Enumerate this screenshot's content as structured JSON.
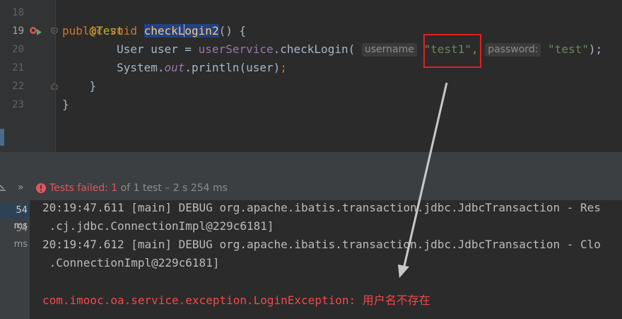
{
  "editor": {
    "line_numbers": [
      "18",
      "19",
      "20",
      "21",
      "22",
      "23"
    ],
    "line18": {
      "annotation": "@Test"
    },
    "line19": {
      "kw_public": "public",
      "kw_void": "void",
      "method_before_caret": "checkL",
      "method_after_caret": "ogin2",
      "rest": "() {"
    },
    "line20": {
      "indent": "        ",
      "decl": "User user = ",
      "service": "userService",
      "call": ".checkLogin(",
      "hint_username": "username",
      "arg1": "\"test1\"",
      "comma": ",",
      "hint_password": "password:",
      "arg2": "\"test\"",
      "close": ");"
    },
    "line21": {
      "indent": "        ",
      "system": "System.",
      "field": "out",
      "call": ".println(user)",
      "semi": ";"
    },
    "line22": {
      "text": "    }"
    },
    "line23": {
      "text": "}"
    }
  },
  "run_panel": {
    "expand_symbol": "»",
    "status": {
      "label": "Tests failed: ",
      "count": "1",
      "detail": " of 1 test – 2 s 254 ms"
    },
    "tree": {
      "row1_time": "54 ms",
      "row2_time": "54 ms"
    },
    "console": {
      "line1": "20:19:47.611 [main] DEBUG org.apache.ibatis.transaction.jdbc.JdbcTransaction - Res",
      "line2": " .cj.jdbc.ConnectionImpl@229c6181]",
      "line3": "20:19:47.612 [main] DEBUG org.apache.ibatis.transaction.jdbc.JdbcTransaction - Clo",
      "line4": " .ConnectionImpl@229c6181]",
      "error_class": "com.imooc.oa.service.exception.LoginException: ",
      "error_message": "用户名不存在"
    }
  },
  "colors": {
    "highlight_box": "#e02020",
    "arrow": "#c8c8c8",
    "error_text": "#f04a4a"
  }
}
